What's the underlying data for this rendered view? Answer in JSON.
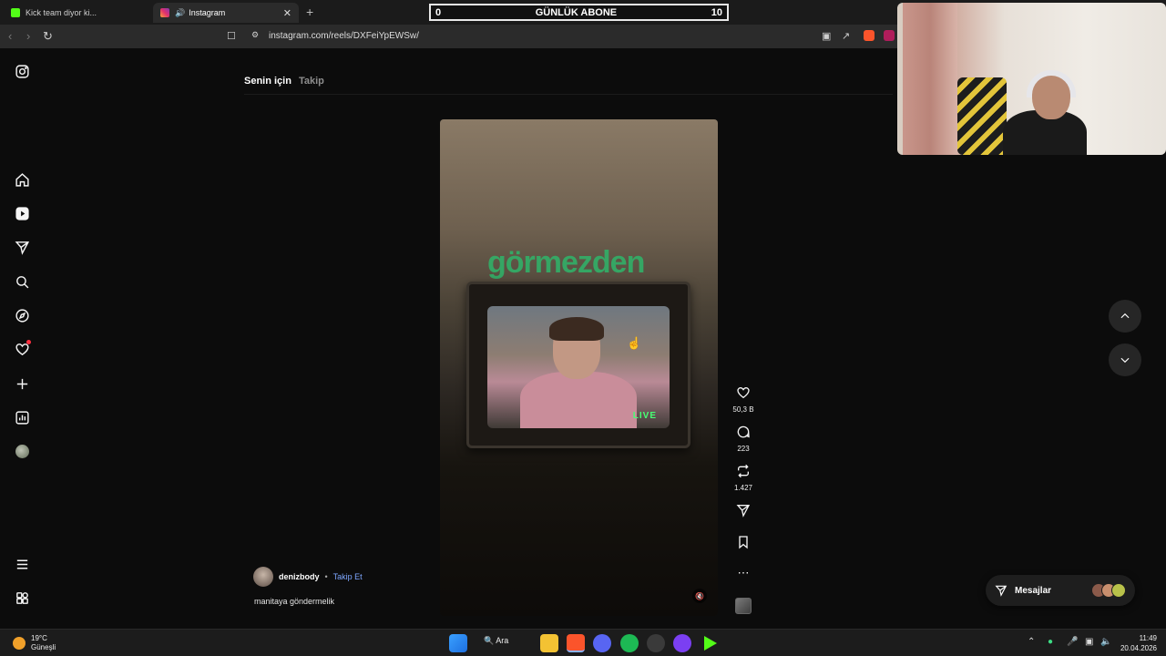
{
  "browser": {
    "tabs": [
      {
        "title": "Kick team diyor ki..."
      },
      {
        "title": "Instagram"
      }
    ],
    "url": "instagram.com/reels/DXFeiYpEWSw/"
  },
  "stream_overlay": {
    "left_value": "0",
    "label": "GÜNLÜK ABONE",
    "right_value": "10"
  },
  "instagram": {
    "feed_tabs": {
      "active": "Senin için",
      "inactive": "Takip"
    },
    "reel": {
      "overlay_text": "görmezden",
      "tv_badge": "LIVE"
    },
    "actions": {
      "likes": "50,3 B",
      "comments": "223",
      "reposts": "1.427"
    },
    "author": {
      "username": "denizbody",
      "separator": "•",
      "follow_label": "Takip Et"
    },
    "caption": "manitaya göndermelik",
    "messages_label": "Mesajlar"
  },
  "taskbar": {
    "weather": {
      "temp": "19°C",
      "condition": "Güneşli"
    },
    "search_label": "Ara",
    "clock": {
      "time": "11:49",
      "date": "20.04.2026"
    }
  },
  "colors": {
    "accent_link": "#7ea7ff",
    "notification": "#ff3040",
    "tv_text": "#47ff74"
  }
}
